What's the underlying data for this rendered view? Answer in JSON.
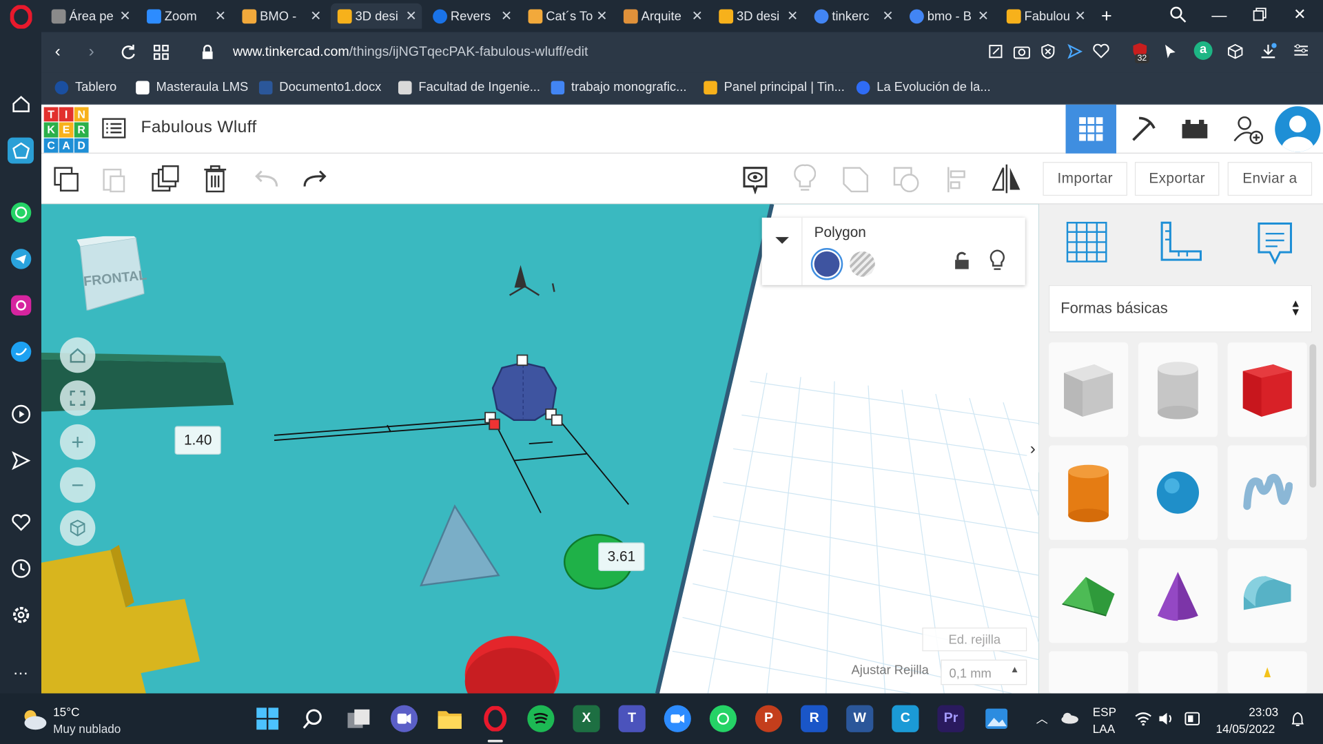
{
  "browser": {
    "tabs": [
      {
        "title": "Área pe",
        "color": "#8a8a8a"
      },
      {
        "title": "Zoom",
        "color": "#2d8cff"
      },
      {
        "title": "BMO - ",
        "color": "#f2a93b"
      },
      {
        "title": "3D desi",
        "color": "#f7b11b",
        "active": true
      },
      {
        "title": "Revers",
        "color": "#1a73e8"
      },
      {
        "title": "Cat´s To",
        "color": "#f2a93b"
      },
      {
        "title": "Arquite",
        "color": "#e0913a"
      },
      {
        "title": "3D desi",
        "color": "#f7b11b"
      },
      {
        "title": "tinkerc",
        "color": "#4285f4"
      },
      {
        "title": "bmo - B",
        "color": "#4285f4"
      },
      {
        "title": "Fabulou",
        "color": "#f7b11b"
      }
    ],
    "url_domain": "www.tinkercad.com",
    "url_path": "/things/ijNGTqecPAK-fabulous-wluff/edit",
    "shield_badge": "32",
    "bookmarks": [
      {
        "label": "Tablero",
        "color": "#1a4fa0"
      },
      {
        "label": "Masteraula LMS",
        "color": "#ffffff"
      },
      {
        "label": "Documento1.docx",
        "color": "#2b579a"
      },
      {
        "label": "Facultad de Ingenie...",
        "color": "#d9d9d9"
      },
      {
        "label": "trabajo monografic...",
        "color": "#4285f4"
      },
      {
        "label": "Panel principal | Tin...",
        "color": "#f7b11b"
      },
      {
        "label": "La Evolución de la...",
        "color": "#2f6cf5"
      }
    ]
  },
  "tinkercad": {
    "logo_letters": [
      "T",
      "I",
      "N",
      "K",
      "E",
      "R",
      "C",
      "A",
      "D"
    ],
    "project_title": "Fabulous Wluff",
    "import_label": "Importar",
    "export_label": "Exportar",
    "send_label": "Enviar a",
    "viewcube_label": "FRONTAL",
    "dim_label_1": "1.40",
    "dim_label_2": "3.61",
    "inspector_title": "Polygon",
    "edit_grid": "Ed. rejilla",
    "snap_grid_label": "Ajustar Rejilla",
    "snap_grid_value": "0,1 mm",
    "shapes_category": "Formas básicas"
  },
  "taskbar": {
    "weather_temp": "15°C",
    "weather_desc": "Muy nublado",
    "lang": "ESP",
    "lang_sub": "LAA",
    "time": "23:03",
    "date": "14/05/2022"
  },
  "colors": {
    "viewport": "#3ab9c0",
    "accent_blue": "#3f8ee0",
    "opera_red": "#e8192c"
  }
}
